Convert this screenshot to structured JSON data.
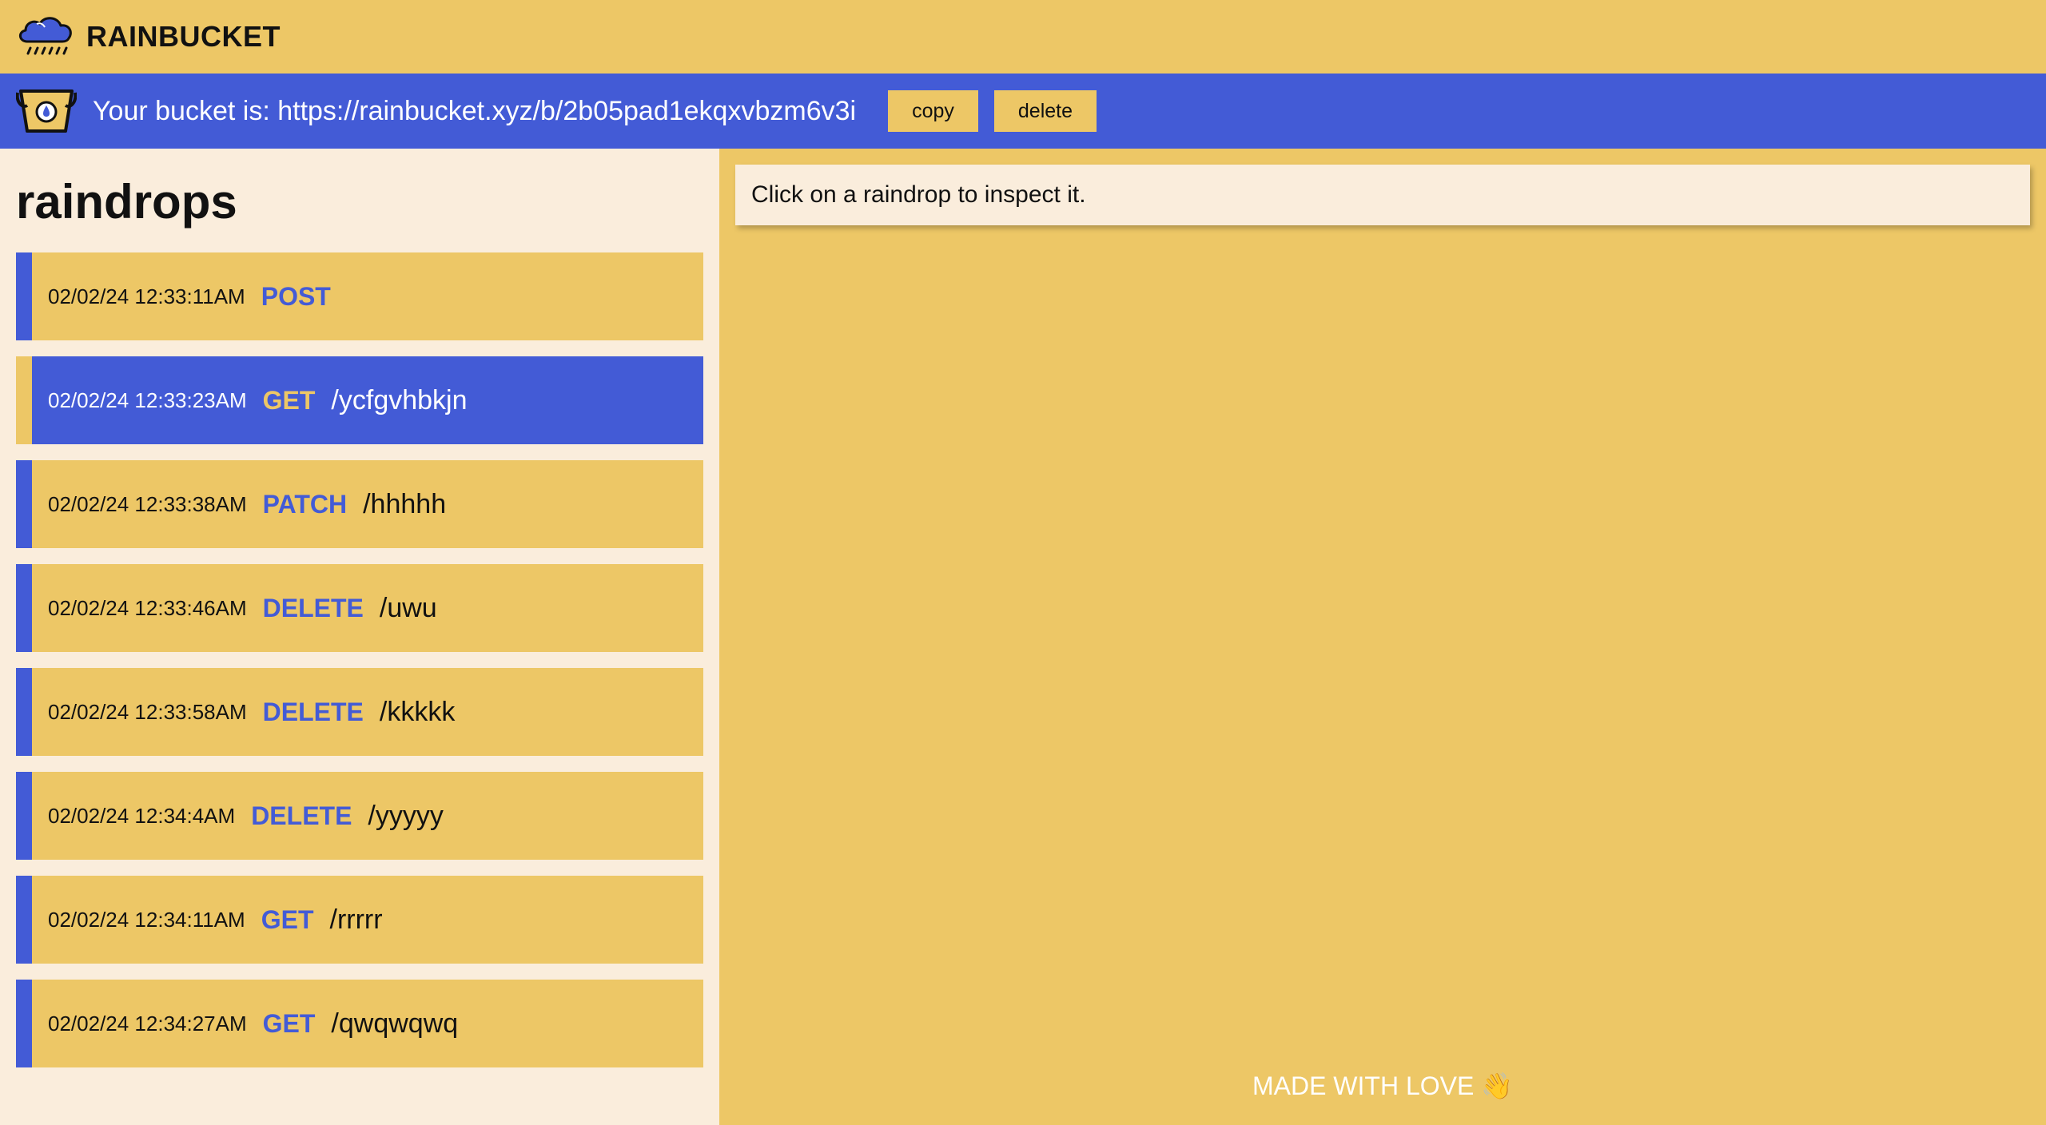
{
  "app": {
    "name": "RAINBUCKET"
  },
  "bucket": {
    "label": "Your bucket is: https://rainbucket.xyz/b/2b05pad1ekqxvbzm6v3i",
    "copy_label": "copy",
    "delete_label": "delete"
  },
  "sidebar": {
    "title": "raindrops",
    "drops": [
      {
        "timestamp": "02/02/24 12:33:11AM",
        "method": "POST",
        "path": ""
      },
      {
        "timestamp": "02/02/24 12:33:23AM",
        "method": "GET",
        "path": "/ycfgvhbkjn",
        "selected": true
      },
      {
        "timestamp": "02/02/24 12:33:38AM",
        "method": "PATCH",
        "path": "/hhhhh"
      },
      {
        "timestamp": "02/02/24 12:33:46AM",
        "method": "DELETE",
        "path": "/uwu"
      },
      {
        "timestamp": "02/02/24 12:33:58AM",
        "method": "DELETE",
        "path": "/kkkkk"
      },
      {
        "timestamp": "02/02/24 12:34:4AM",
        "method": "DELETE",
        "path": "/yyyyy"
      },
      {
        "timestamp": "02/02/24 12:34:11AM",
        "method": "GET",
        "path": "/rrrrr"
      },
      {
        "timestamp": "02/02/24 12:34:27AM",
        "method": "GET",
        "path": "/qwqwqwq"
      }
    ]
  },
  "main": {
    "hint": "Click on a raindrop to inspect it."
  },
  "footer": {
    "text": "MADE WITH LOVE 👋"
  },
  "colors": {
    "accent_blue": "#435bd6",
    "accent_yellow": "#edc766",
    "panel_cream": "#faeddc"
  },
  "icons": {
    "logo": "cloud-rain-icon",
    "bucket": "bucket-icon"
  }
}
